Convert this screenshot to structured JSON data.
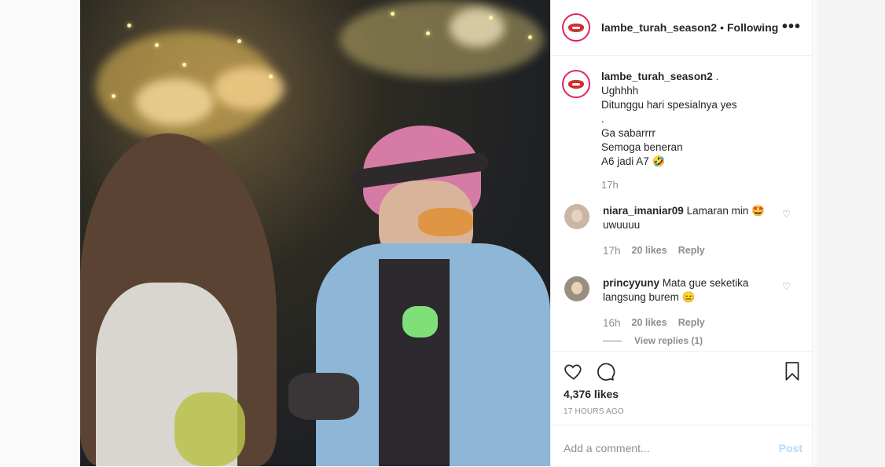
{
  "post": {
    "username": "lambe_turah_season2",
    "separator": "•",
    "follow_status": "Following",
    "more_icon": "more-options-icon"
  },
  "caption": {
    "username": "lambe_turah_season2",
    "lines": [
      "lambe_turah_season2 .",
      "Ughhhh",
      "Ditunggu hari spesialnya yes",
      ".",
      "Ga sabarrrr",
      "Semoga beneran",
      "A6 jadi A7 🤣"
    ],
    "time": "17h"
  },
  "comments": [
    {
      "username": "niara_imaniar09",
      "text": "Lamaran min 🤩 uwuuuu",
      "time": "17h",
      "likes": "20 likes",
      "reply": "Reply"
    },
    {
      "username": "princyyuny",
      "text": "Mata gue seketika langsung burem 😑",
      "time": "16h",
      "likes": "20 likes",
      "reply": "Reply"
    }
  ],
  "view_replies": "View replies (1)",
  "stats": {
    "likes": "4,376 likes",
    "posted": "17 HOURS AGO"
  },
  "add_comment": {
    "placeholder": "Add a comment...",
    "post_label": "Post"
  },
  "colors": {
    "accent_link": "#b3dbff",
    "muted": "#8e8e8e",
    "avatar_ring": "#e0245e"
  }
}
